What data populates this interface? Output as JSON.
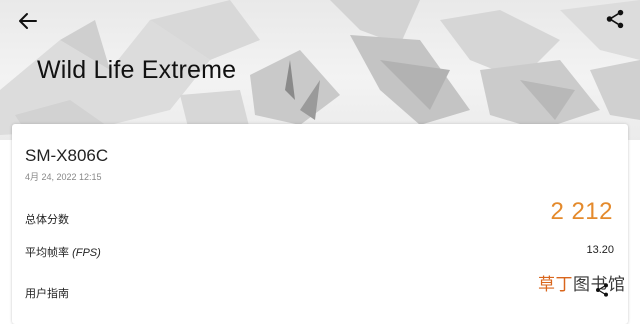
{
  "header": {
    "title": "Wild Life Extreme",
    "back_icon": "arrow-left-icon",
    "share_icon": "share-icon"
  },
  "result": {
    "device": "SM-X806C",
    "date": "4月 24, 2022 12:15",
    "overall_score_label": "总体分数",
    "overall_score_value": "2 212",
    "avg_fps_label_prefix": "平均帧率 ",
    "avg_fps_label_unit": "(FPS)",
    "avg_fps_value": "13.20",
    "guide_label": "用户指南",
    "guide_icon": "share-icon"
  },
  "watermark": {
    "accent_text": "草丁",
    "text": "图书馆"
  },
  "colors": {
    "score": "#e48a2c",
    "watermark_accent": "#d9661c"
  }
}
